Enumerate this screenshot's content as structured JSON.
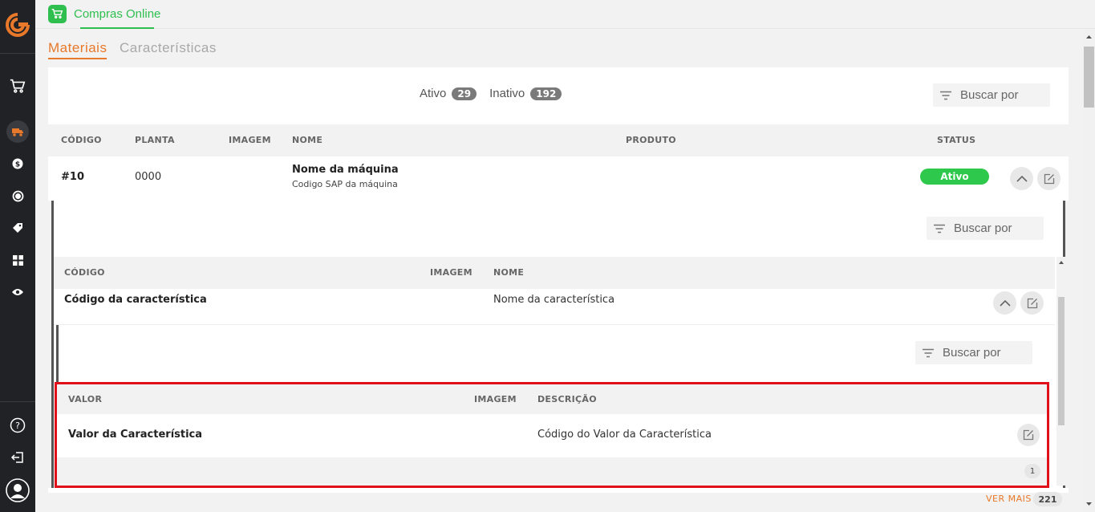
{
  "app": {
    "name": "Compras Online"
  },
  "tabs": [
    {
      "label": "Materiais",
      "active": true
    },
    {
      "label": "Características",
      "active": false
    }
  ],
  "counts": {
    "active_label": "Ativo",
    "active_count": "29",
    "inactive_label": "Inativo",
    "inactive_count": "192"
  },
  "search": {
    "placeholder": "Buscar por"
  },
  "main_table": {
    "headers": {
      "codigo": "CÓDIGO",
      "planta": "PLANTA",
      "imagem": "IMAGEM",
      "nome": "NOME",
      "produto": "PRODUTO",
      "status": "STATUS"
    },
    "row": {
      "codigo": "#10",
      "planta": "0000",
      "nome": "Nome da máquina",
      "nome_sub": "Codigo SAP da máquina",
      "status": "Ativo"
    }
  },
  "char_table": {
    "headers": {
      "codigo": "CÓDIGO",
      "imagem": "IMAGEM",
      "nome": "NOME"
    },
    "row": {
      "codigo": "Código da característica",
      "nome": "Nome da característica"
    }
  },
  "value_table": {
    "headers": {
      "valor": "VALOR",
      "imagem": "IMAGEM",
      "descricao": "DESCRIÇÃO"
    },
    "row": {
      "valor": "Valor da Característica",
      "descricao": "Código do Valor da Característica"
    },
    "page": "1"
  },
  "footer": {
    "ver_mais": "VER MAIS",
    "total": "221"
  },
  "colors": {
    "accent": "#e8782a",
    "brand_green": "#2fbf4f",
    "status_green": "#2ec84c",
    "highlight_red": "#e0101a",
    "sidebar": "#212226"
  },
  "sidebar_icons": [
    "logo-icon",
    "cart-icon",
    "truck-icon",
    "dollar-icon",
    "refresh-dollar-icon",
    "tag-icon",
    "grid-icon",
    "eye-icon",
    "help-icon",
    "logout-icon",
    "user-icon"
  ]
}
